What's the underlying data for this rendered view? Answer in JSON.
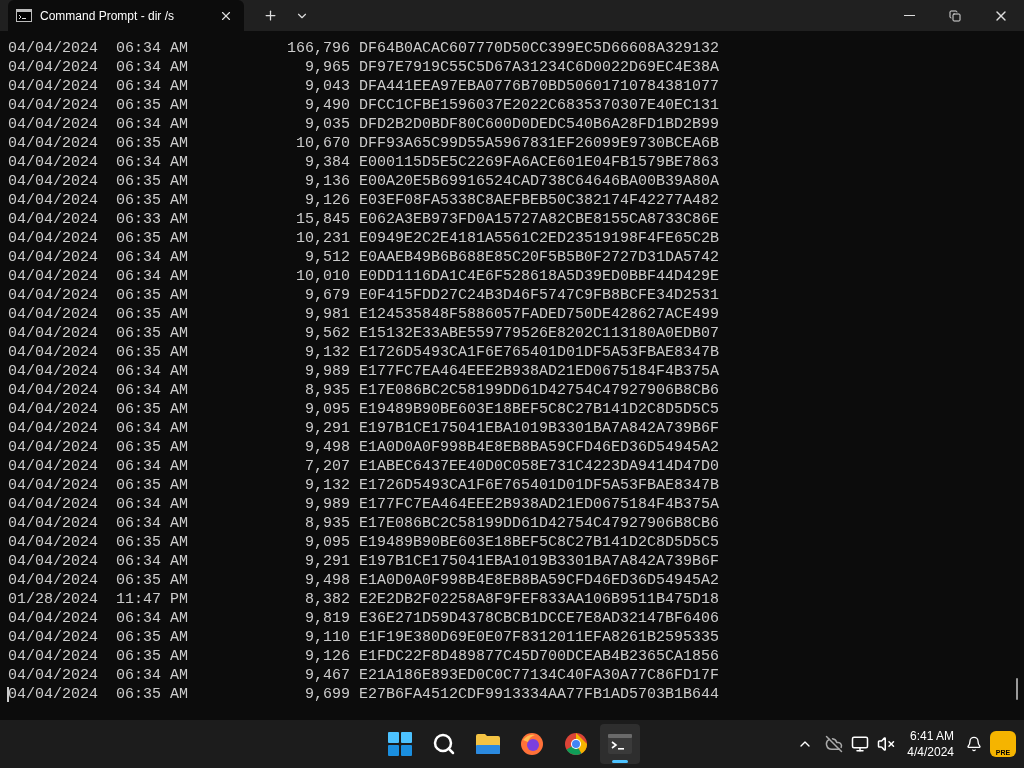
{
  "window": {
    "tab_title": "Command Prompt - dir /s"
  },
  "terminal": {
    "lines": [
      "04/04/2024  06:34 AM           166,796 DF64B0ACAC607770D50CC399EC5D66608A329132",
      "04/04/2024  06:34 AM             9,965 DF97E7919C55C5D67A31234C6D0022D69EC4E38A",
      "04/04/2024  06:34 AM             9,043 DFA441EEA97EBA0776B70BD50601710784381077",
      "04/04/2024  06:35 AM             9,490 DFCC1CFBE1596037E2022C6835370307E40EC131",
      "04/04/2024  06:34 AM             9,035 DFD2B2D0BDF80C600D0DEDC540B6A28FD1BD2B99",
      "04/04/2024  06:35 AM            10,670 DFF93A65C99D55A5967831EF26099E9730BCEA6B",
      "04/04/2024  06:34 AM             9,384 E000115D5E5C2269FA6ACE601E04FB1579BE7863",
      "04/04/2024  06:35 AM             9,136 E00A20E5B69916524CAD738C64646BA00B39A80A",
      "04/04/2024  06:35 AM             9,126 E03EF08FA5338C8AEFBEB50C382174F42277A482",
      "04/04/2024  06:33 AM            15,845 E062A3EB973FD0A15727A82CBE8155CA8733C86E",
      "04/04/2024  06:35 AM            10,231 E0949E2C2E4181A5561C2ED23519198F4FE65C2B",
      "04/04/2024  06:34 AM             9,512 E0AAEB49B6B688E85C20F5B5B0F2727D31DA5742",
      "04/04/2024  06:34 AM            10,010 E0DD1116DA1C4E6F528618A5D39ED0BBF44D429E",
      "04/04/2024  06:35 AM             9,679 E0F415FDD27C24B3D46F5747C9FB8BCFE34D2531",
      "04/04/2024  06:35 AM             9,981 E124535848F5886057FADED750DE428627ACE499",
      "04/04/2024  06:35 AM             9,562 E15132E33ABE559779526E8202C113180A0EDB07",
      "04/04/2024  06:35 AM             9,132 E1726D5493CA1F6E765401D01DF5A53FBAE8347B",
      "04/04/2024  06:34 AM             9,989 E177FC7EA464EEE2B938AD21ED0675184F4B375A",
      "04/04/2024  06:34 AM             8,935 E17E086BC2C58199DD61D42754C47927906B8CB6",
      "04/04/2024  06:35 AM             9,095 E19489B90BE603E18BEF5C8C27B141D2C8D5D5C5",
      "04/04/2024  06:34 AM             9,291 E197B1CE175041EBA1019B3301BA7A842A739B6F",
      "04/04/2024  06:35 AM             9,498 E1A0D0A0F998B4E8EB8BA59CFD46ED36D54945A2",
      "04/04/2024  06:34 AM             7,207 E1ABEC6437EE40D0C058E731C4223DA9414D47D0",
      "04/04/2024  06:35 AM             9,132 E1726D5493CA1F6E765401D01DF5A53FBAE8347B",
      "04/04/2024  06:34 AM             9,989 E177FC7EA464EEE2B938AD21ED0675184F4B375A",
      "04/04/2024  06:34 AM             8,935 E17E086BC2C58199DD61D42754C47927906B8CB6",
      "04/04/2024  06:35 AM             9,095 E19489B90BE603E18BEF5C8C27B141D2C8D5D5C5",
      "04/04/2024  06:34 AM             9,291 E197B1CE175041EBA1019B3301BA7A842A739B6F",
      "04/04/2024  06:35 AM             9,498 E1A0D0A0F998B4E8EB8BA59CFD46ED36D54945A2",
      "01/28/2024  11:47 PM             8,382 E2E2DB2F02258A8F9FEF833AA106B9511B475D18",
      "04/04/2024  06:34 AM             9,819 E36E271D59D4378CBCB1DCCE7E8AD32147BF6406",
      "04/04/2024  06:35 AM             9,110 E1F19E380D69E0E07F8312011EFA8261B2595335",
      "04/04/2024  06:35 AM             9,126 E1FDC22F8D489877C45D700DCEAB4B2365CA1856",
      "04/04/2024  06:34 AM             9,467 E21A186E893ED0C0C77134C40FA30A77C86FD17F",
      "04/04/2024  06:35 AM             9,699 E27B6FA4512CDF9913334AA77FB1AD5703B1B644"
    ]
  },
  "taskbar": {
    "apps": [
      {
        "kind": "start",
        "selected": false
      },
      {
        "kind": "search",
        "selected": false
      },
      {
        "kind": "files",
        "selected": false
      },
      {
        "kind": "firefox",
        "selected": false
      },
      {
        "kind": "chrome",
        "selected": false
      },
      {
        "kind": "terminal",
        "selected": true
      }
    ],
    "clock": {
      "time": "6:41 AM",
      "date": "4/4/2024"
    },
    "copilot_badge": "PRE"
  }
}
